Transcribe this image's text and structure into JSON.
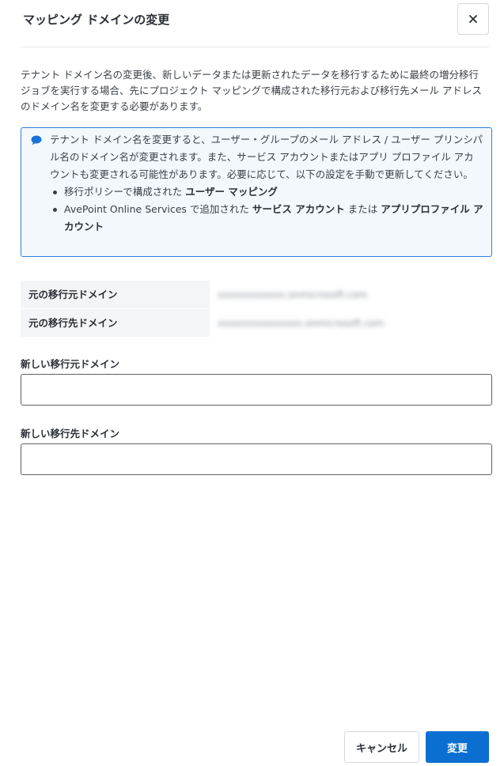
{
  "dialog": {
    "title": "マッピング ドメインの変更",
    "description": "テナント ドメイン名の変更後、新しいデータまたは更新されたデータを移行するために最終の増分移行ジョブを実行する場合、先にプロジェクト マッピングで構成された移行元および移行先メール アドレスのドメイン名を変更する必要があります。"
  },
  "info": {
    "text": "テナント ドメイン名を変更すると、ユーザー・グループのメール アドレス / ユーザー プリンシパル名のドメイン名が変更されます。また、サービス アカウントまたはアプリ プロファイル アカウントも変更される可能性があります。必要に応じて、以下の設定を手動で更新してください。",
    "bullet1_prefix": "移行ポリシーで構成された",
    "bullet1_bold": "ユーザー マッピング",
    "bullet2_prefix": "AvePoint Online Services で追加された",
    "bullet2_bold1": "サービス アカウント",
    "bullet2_mid": "または",
    "bullet2_bold2": "アプリプロファイル アカウント"
  },
  "domains": {
    "source_label": "元の移行元ドメイン",
    "source_value": "xxxxxxxxxxxx.onmicrosoft.com",
    "target_label": "元の移行先ドメイン",
    "target_value": "xxxxxxxxxxxxxxx.onmicrosoft.com"
  },
  "form": {
    "new_source_label": "新しい移行元ドメイン",
    "new_source_value": "",
    "new_target_label": "新しい移行先ドメイン",
    "new_target_value": ""
  },
  "footer": {
    "cancel_label": "キャンセル",
    "submit_label": "変更"
  },
  "colors": {
    "primary": "#0a6fd1",
    "info_border": "#2f80d9",
    "info_background": "#f3f8fd"
  }
}
